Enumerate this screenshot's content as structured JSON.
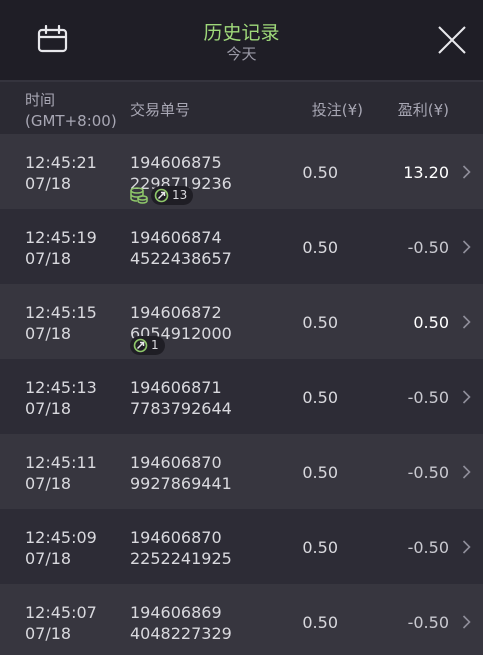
{
  "header": {
    "title": "历史记录",
    "subtitle": "今天",
    "calendar_icon": "calendar-icon",
    "close_icon": "close-icon",
    "accent_color": "#9fd97a"
  },
  "columns": {
    "time_line1": "时间",
    "time_line2": "(GMT+8:00)",
    "order": "交易单号",
    "bet": "投注(¥)",
    "profit": "盈利(¥)"
  },
  "rows": [
    {
      "time": "12:45:21",
      "date": "07/18",
      "order1": "194606875",
      "order2": "2298719236",
      "bet": "0.50",
      "profit": "13.20",
      "win": true,
      "badge": "13",
      "coin": true
    },
    {
      "time": "12:45:19",
      "date": "07/18",
      "order1": "194606874",
      "order2": "4522438657",
      "bet": "0.50",
      "profit": "-0.50",
      "win": false
    },
    {
      "time": "12:45:15",
      "date": "07/18",
      "order1": "194606872",
      "order2": "6054912000",
      "bet": "0.50",
      "profit": "0.50",
      "win": true,
      "badge": "1",
      "coin": false
    },
    {
      "time": "12:45:13",
      "date": "07/18",
      "order1": "194606871",
      "order2": "7783792644",
      "bet": "0.50",
      "profit": "-0.50",
      "win": false
    },
    {
      "time": "12:45:11",
      "date": "07/18",
      "order1": "194606870",
      "order2": "9927869441",
      "bet": "0.50",
      "profit": "-0.50",
      "win": false
    },
    {
      "time": "12:45:09",
      "date": "07/18",
      "order1": "194606870",
      "order2": "2252241925",
      "bet": "0.50",
      "profit": "-0.50",
      "win": false
    },
    {
      "time": "12:45:07",
      "date": "07/18",
      "order1": "194606869",
      "order2": "4048227329",
      "bet": "0.50",
      "profit": "-0.50",
      "win": false
    }
  ]
}
